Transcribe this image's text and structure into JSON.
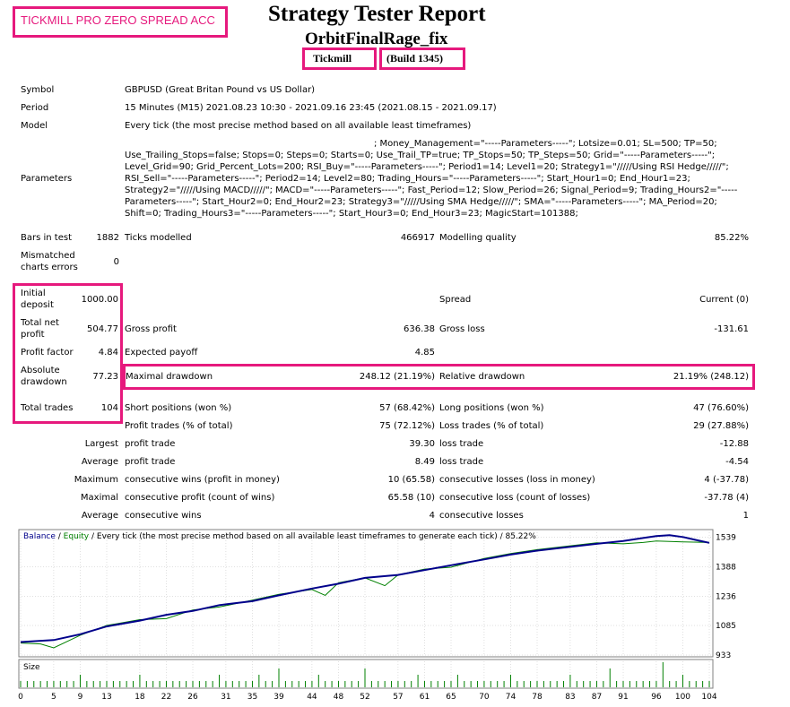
{
  "header": {
    "broker_badge": "TICKMILL PRO ZERO SPREAD ACC",
    "title": "Strategy Tester Report",
    "ea_name": "OrbitFinalRage_fix",
    "company": "Tickmill",
    "build": "(Build 1345)"
  },
  "info": {
    "symbol_label": "Symbol",
    "symbol_value": "GBPUSD (Great Britan Pound vs US Dollar)",
    "period_label": "Period",
    "period_value": "15 Minutes (M15) 2021.08.23 10:30 - 2021.09.16 23:45 (2021.08.15 - 2021.09.17)",
    "model_label": "Model",
    "model_value": "Every tick (the most precise method based on all available least timeframes)",
    "params_label": "Parameters",
    "params_lines": [
      "; Money_Management=\"-----Parameters-----\"; Lotsize=0.01; SL=500; TP=50;",
      "Use_Trailing_Stops=false; Stops=0; Steps=0; Starts=0; Use_Trail_TP=true; TP_Stops=50; TP_Steps=50; Grid=\"-----Parameters-----\";",
      "Level_Grid=90; Grid_Percent_Lots=200; RSI_Buy=\"-----Parameters-----\"; Period1=14; Level1=20; Strategy1=\"/////Using RSI Hedge/////\";",
      "RSI_Sell=\"-----Parameters-----\"; Period2=14; Level2=80; Trading_Hours=\"-----Parameters-----\"; Start_Hour1=0; End_Hour1=23;",
      "Strategy2=\"/////Using MACD/////\"; MACD=\"-----Parameters-----\"; Fast_Period=12; Slow_Period=26; Signal_Period=9; Trading_Hours2=\"-----",
      "Parameters-----\"; Start_Hour2=0; End_Hour2=23; Strategy3=\"/////Using SMA Hedge/////\"; SMA=\"-----Parameters-----\"; MA_Period=20;",
      "Shift=0; Trading_Hours3=\"-----Parameters-----\"; Start_Hour3=0; End_Hour3=23; MagicStart=101388;"
    ]
  },
  "stats": {
    "bars_label": "Bars in test",
    "bars_value": "1882",
    "ticks_label": "Ticks modelled",
    "ticks_value": "466917",
    "quality_label": "Modelling quality",
    "quality_value": "85.22%",
    "mismatch_label_1": "Mismatched",
    "mismatch_label_2": "charts errors",
    "mismatch_value": "0",
    "deposit_label_1": "Initial",
    "deposit_label_2": "deposit",
    "deposit_value": "1000.00",
    "spread_label": "Spread",
    "spread_value": "Current (0)",
    "net_label_1": "Total net",
    "net_label_2": "profit",
    "net_value": "504.77",
    "gross_profit_label": "Gross profit",
    "gross_profit_value": "636.38",
    "gross_loss_label": "Gross loss",
    "gross_loss_value": "-131.61",
    "pf_label": "Profit factor",
    "pf_value": "4.84",
    "payoff_label": "Expected payoff",
    "payoff_value": "4.85",
    "absdd_label_1": "Absolute",
    "absdd_label_2": "drawdown",
    "absdd_value": "77.23",
    "maxdd_label": "Maximal drawdown",
    "maxdd_value": "248.12 (21.19%)",
    "reldd_label": "Relative drawdown",
    "reldd_value": "21.19% (248.12)",
    "trades_label": "Total trades",
    "trades_value": "104",
    "short_label": "Short positions (won %)",
    "short_value": "57 (68.42%)",
    "long_label": "Long positions (won %)",
    "long_value": "47 (76.60%)",
    "ptrades_label": "Profit trades (% of total)",
    "ptrades_value": "75 (72.12%)",
    "ltrades_label": "Loss trades (% of total)",
    "ltrades_value": "29 (27.88%)",
    "largest_label": "Largest",
    "largest_pt_label": "profit trade",
    "largest_pt_value": "39.30",
    "largest_lt_label": "loss trade",
    "largest_lt_value": "-12.88",
    "average_label": "Average",
    "average_pt_label": "profit trade",
    "average_pt_value": "8.49",
    "average_lt_label": "loss trade",
    "average_lt_value": "-4.54",
    "maximum_label": "Maximum",
    "max_cw_label": "consecutive wins (profit in money)",
    "max_cw_value": "10 (65.58)",
    "max_cl_label": "consecutive losses (loss in money)",
    "max_cl_value": "4 (-37.78)",
    "maximal_label": "Maximal",
    "maxl_cp_label": "consecutive profit (count of wins)",
    "maxl_cp_value": "65.58 (10)",
    "maxl_cl_label": "consecutive loss (count of losses)",
    "maxl_cl_value": "-37.78 (4)",
    "avg2_label": "Average",
    "avg_cw_label": "consecutive wins",
    "avg_cw_value": "4",
    "avg_cl_label": "consecutive losses",
    "avg_cl_value": "1"
  },
  "chart_data": {
    "type": "line",
    "legend_balance": "Balance",
    "legend_sep": " / ",
    "legend_equity": "Equity",
    "legend_rest": " / Every tick (the most precise method based on all available least timeframes to generate each tick) / 85.22%",
    "size_label": "Size",
    "colors": {
      "balance": "#00008b",
      "equity": "#008000",
      "size": "#008000",
      "grid": "#c0c0c0"
    },
    "ylim": [
      933,
      1560
    ],
    "y_ticks": [
      1539,
      1388,
      1236,
      1085,
      933
    ],
    "x_ticks": [
      0,
      5,
      9,
      13,
      18,
      22,
      26,
      31,
      35,
      39,
      44,
      48,
      52,
      57,
      61,
      65,
      70,
      74,
      78,
      83,
      87,
      91,
      96,
      100,
      104
    ],
    "x_max": 104,
    "balance": [
      [
        0,
        1000
      ],
      [
        5,
        1010
      ],
      [
        9,
        1040
      ],
      [
        13,
        1080
      ],
      [
        18,
        1110
      ],
      [
        22,
        1140
      ],
      [
        26,
        1160
      ],
      [
        30,
        1190
      ],
      [
        35,
        1210
      ],
      [
        39,
        1240
      ],
      [
        44,
        1275
      ],
      [
        48,
        1300
      ],
      [
        52,
        1330
      ],
      [
        57,
        1345
      ],
      [
        61,
        1370
      ],
      [
        65,
        1395
      ],
      [
        70,
        1425
      ],
      [
        74,
        1450
      ],
      [
        78,
        1470
      ],
      [
        83,
        1490
      ],
      [
        87,
        1505
      ],
      [
        91,
        1520
      ],
      [
        94,
        1535
      ],
      [
        96,
        1545
      ],
      [
        98,
        1550
      ],
      [
        100,
        1540
      ],
      [
        102,
        1525
      ],
      [
        104,
        1510
      ]
    ],
    "equity": [
      [
        0,
        995
      ],
      [
        3,
        990
      ],
      [
        5,
        970
      ],
      [
        9,
        1035
      ],
      [
        13,
        1085
      ],
      [
        18,
        1115
      ],
      [
        22,
        1120
      ],
      [
        26,
        1165
      ],
      [
        30,
        1180
      ],
      [
        35,
        1215
      ],
      [
        39,
        1245
      ],
      [
        44,
        1270
      ],
      [
        46,
        1240
      ],
      [
        48,
        1305
      ],
      [
        52,
        1330
      ],
      [
        55,
        1290
      ],
      [
        57,
        1345
      ],
      [
        61,
        1375
      ],
      [
        65,
        1385
      ],
      [
        70,
        1430
      ],
      [
        74,
        1455
      ],
      [
        78,
        1475
      ],
      [
        83,
        1495
      ],
      [
        87,
        1510
      ],
      [
        91,
        1505
      ],
      [
        94,
        1512
      ],
      [
        96,
        1520
      ],
      [
        100,
        1515
      ],
      [
        104,
        1512
      ]
    ],
    "size_values": [
      1,
      1,
      1,
      1,
      1,
      1,
      1,
      1,
      1,
      2,
      1,
      1,
      1,
      1,
      1,
      1,
      1,
      1,
      2,
      1,
      1,
      1,
      1,
      1,
      1,
      1,
      1,
      1,
      1,
      1,
      2,
      1,
      1,
      1,
      1,
      1,
      2,
      1,
      1,
      3,
      1,
      1,
      1,
      1,
      1,
      2,
      1,
      1,
      1,
      1,
      1,
      1,
      3,
      1,
      1,
      1,
      1,
      1,
      1,
      1,
      2,
      1,
      1,
      1,
      1,
      1,
      2,
      1,
      1,
      1,
      1,
      1,
      1,
      1,
      2,
      1,
      1,
      1,
      1,
      1,
      1,
      1,
      1,
      2,
      1,
      1,
      1,
      1,
      1,
      3,
      1,
      1,
      1,
      1,
      1,
      1,
      1,
      4,
      1,
      1,
      2,
      1,
      1,
      1,
      1
    ]
  }
}
